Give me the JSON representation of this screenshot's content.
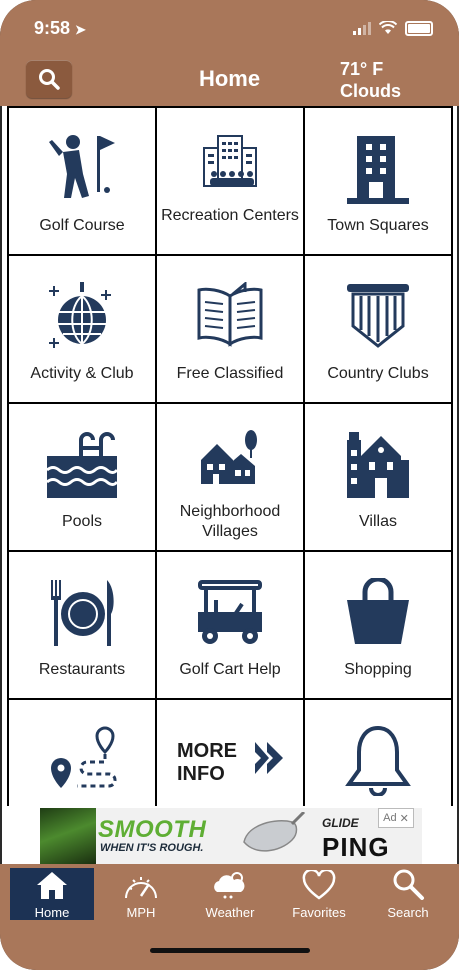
{
  "status": {
    "time": "9:58"
  },
  "header": {
    "title": "Home",
    "temperature": "71° F",
    "condition": "Clouds"
  },
  "colors": {
    "brand_brown": "#a9775a",
    "icon_navy": "#233a5c",
    "active_tab": "#1c3254"
  },
  "tiles": [
    {
      "label": "Golf Course",
      "icon": "golfer-icon"
    },
    {
      "label": "Recreation Centers",
      "icon": "recreation-building-icon"
    },
    {
      "label": "Town Squares",
      "icon": "tower-building-icon"
    },
    {
      "label": "Activity & Club",
      "icon": "disco-ball-icon"
    },
    {
      "label": "Free Classified",
      "icon": "open-book-icon"
    },
    {
      "label": "Country Clubs",
      "icon": "pennant-banner-icon"
    },
    {
      "label": "Pools",
      "icon": "pool-ladder-icon"
    },
    {
      "label": "Neighborhood Villages",
      "icon": "village-houses-icon"
    },
    {
      "label": "Villas",
      "icon": "villa-house-icon"
    },
    {
      "label": "Restaurants",
      "icon": "plate-cutlery-icon"
    },
    {
      "label": "Golf Cart Help",
      "icon": "golf-cart-icon"
    },
    {
      "label": "Shopping",
      "icon": "shopping-bag-icon"
    },
    {
      "label": "",
      "icon": "route-map-icon"
    },
    {
      "label": "MORE\nINFO",
      "icon": "double-chevron-right-icon"
    },
    {
      "label": "",
      "icon": "bell-icon"
    }
  ],
  "ad": {
    "headline": "SMOOTH",
    "subline": "WHEN IT'S ROUGH.",
    "product": "GLIDE",
    "brand": "PING",
    "badge": "Ad",
    "close": "✕"
  },
  "tabs": [
    {
      "label": "Home",
      "icon": "house-icon",
      "active": true
    },
    {
      "label": "MPH",
      "icon": "speedometer-icon",
      "active": false
    },
    {
      "label": "Weather",
      "icon": "rain-cloud-icon",
      "active": false
    },
    {
      "label": "Favorites",
      "icon": "heart-icon",
      "active": false
    },
    {
      "label": "Search",
      "icon": "magnifier-icon",
      "active": false
    }
  ]
}
